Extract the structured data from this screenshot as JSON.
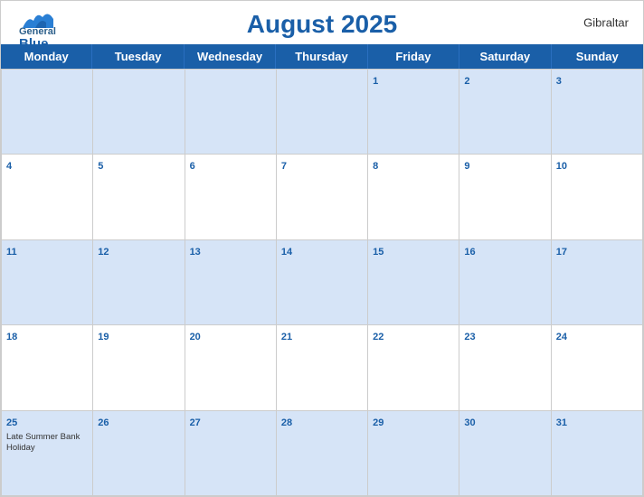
{
  "header": {
    "title": "August 2025",
    "region": "Gibraltar",
    "logo_general": "General",
    "logo_blue": "Blue"
  },
  "days": [
    "Monday",
    "Tuesday",
    "Wednesday",
    "Thursday",
    "Friday",
    "Saturday",
    "Sunday"
  ],
  "weeks": [
    [
      {
        "date": "",
        "event": ""
      },
      {
        "date": "",
        "event": ""
      },
      {
        "date": "",
        "event": ""
      },
      {
        "date": "",
        "event": ""
      },
      {
        "date": "1",
        "event": ""
      },
      {
        "date": "2",
        "event": ""
      },
      {
        "date": "3",
        "event": ""
      }
    ],
    [
      {
        "date": "4",
        "event": ""
      },
      {
        "date": "5",
        "event": ""
      },
      {
        "date": "6",
        "event": ""
      },
      {
        "date": "7",
        "event": ""
      },
      {
        "date": "8",
        "event": ""
      },
      {
        "date": "9",
        "event": ""
      },
      {
        "date": "10",
        "event": ""
      }
    ],
    [
      {
        "date": "11",
        "event": ""
      },
      {
        "date": "12",
        "event": ""
      },
      {
        "date": "13",
        "event": ""
      },
      {
        "date": "14",
        "event": ""
      },
      {
        "date": "15",
        "event": ""
      },
      {
        "date": "16",
        "event": ""
      },
      {
        "date": "17",
        "event": ""
      }
    ],
    [
      {
        "date": "18",
        "event": ""
      },
      {
        "date": "19",
        "event": ""
      },
      {
        "date": "20",
        "event": ""
      },
      {
        "date": "21",
        "event": ""
      },
      {
        "date": "22",
        "event": ""
      },
      {
        "date": "23",
        "event": ""
      },
      {
        "date": "24",
        "event": ""
      }
    ],
    [
      {
        "date": "25",
        "event": "Late Summer Bank Holiday"
      },
      {
        "date": "26",
        "event": ""
      },
      {
        "date": "27",
        "event": ""
      },
      {
        "date": "28",
        "event": ""
      },
      {
        "date": "29",
        "event": ""
      },
      {
        "date": "30",
        "event": ""
      },
      {
        "date": "31",
        "event": ""
      }
    ]
  ],
  "colors": {
    "header_blue": "#1a5fa8",
    "stripe_blue": "#d6e4f7",
    "border": "#ccc"
  }
}
